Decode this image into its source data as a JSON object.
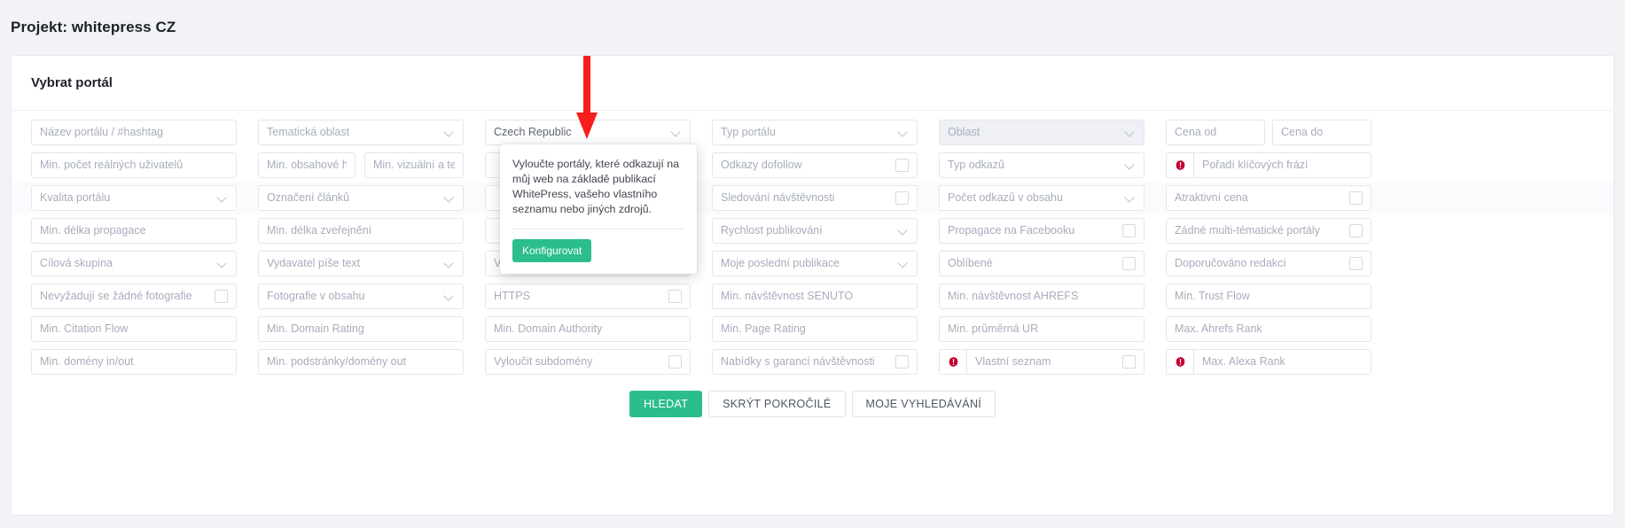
{
  "header": {
    "title": "Projekt: whitepress CZ"
  },
  "card": {
    "title": "Vybrat portál"
  },
  "rows": [
    {
      "alt": false,
      "cells": [
        {
          "name": "portal-name-field",
          "label": "Název portálu / #hashtag",
          "kind": "text",
          "col": "c1"
        },
        {
          "name": "thematic-area-field",
          "label": "Tematická oblast",
          "kind": "select",
          "col": "c2"
        },
        {
          "name": "country-field",
          "label": "Czech Republic",
          "kind": "select",
          "col": "c3",
          "filled": true
        },
        {
          "name": "portal-type-field",
          "label": "Typ portálu",
          "kind": "select",
          "col": "c4"
        },
        {
          "name": "region-field",
          "label": "Oblast",
          "kind": "select",
          "col": "c5",
          "disabled": true
        },
        {
          "name": "price-from-field",
          "label": "Cena od",
          "kind": "text",
          "col": "c6a"
        },
        {
          "name": "price-to-field",
          "label": "Cena do",
          "kind": "text",
          "col": "c6b"
        }
      ]
    },
    {
      "alt": false,
      "cells": [
        {
          "name": "min-real-users-field",
          "label": "Min. počet reálných uživatelů",
          "kind": "text",
          "col": "c1"
        },
        {
          "name": "min-content-rating-field",
          "label": "Min. obsahové hoc",
          "kind": "text",
          "col": "c2a"
        },
        {
          "name": "min-visual-tech-field",
          "label": "Min. vizuální a tecl",
          "kind": "text",
          "col": "c2b"
        },
        {
          "name": "exclude-linked-field",
          "label": "",
          "kind": "text",
          "col": "c3"
        },
        {
          "name": "dofollow-links-field",
          "label": "Odkazy dofollow",
          "kind": "checkbox",
          "col": "c4"
        },
        {
          "name": "link-type-field",
          "label": "Typ odkazů",
          "kind": "select",
          "col": "c5"
        },
        {
          "name": "keyword-ranking-field",
          "label": "Pořadí klíčových frází",
          "kind": "warn-text",
          "col": "c6"
        }
      ]
    },
    {
      "alt": true,
      "cells": [
        {
          "name": "portal-quality-field",
          "label": "Kvalita portálu",
          "kind": "select",
          "col": "c1"
        },
        {
          "name": "article-marking-field",
          "label": "Označení článků",
          "kind": "select",
          "col": "c2"
        },
        {
          "name": "hidden-field-3",
          "label": "",
          "kind": "text",
          "col": "c3"
        },
        {
          "name": "traffic-tracking-field",
          "label": "Sledování návštěvnosti",
          "kind": "checkbox",
          "col": "c4"
        },
        {
          "name": "links-in-content-field",
          "label": "Počet odkazů v obsahu",
          "kind": "select",
          "col": "c5"
        },
        {
          "name": "attractive-price-field",
          "label": "Atraktivní cena",
          "kind": "checkbox",
          "col": "c6"
        }
      ]
    },
    {
      "alt": false,
      "cells": [
        {
          "name": "min-promotion-length-field",
          "label": "Min. délka propagace",
          "kind": "text",
          "col": "c1"
        },
        {
          "name": "min-publication-length-field",
          "label": "Min. délka zveřejnění",
          "kind": "text",
          "col": "c2"
        },
        {
          "name": "hidden-field-4",
          "label": "",
          "kind": "text",
          "col": "c3"
        },
        {
          "name": "publication-speed-field",
          "label": "Rychlost publikování",
          "kind": "select",
          "col": "c4"
        },
        {
          "name": "facebook-promo-field",
          "label": "Propagace na Facebooku",
          "kind": "checkbox",
          "col": "c5"
        },
        {
          "name": "no-multi-thematic-field",
          "label": "Žádné multi-tématické portály",
          "kind": "checkbox",
          "col": "c6"
        }
      ]
    },
    {
      "alt": false,
      "cells": [
        {
          "name": "target-group-field",
          "label": "Cílová skupina",
          "kind": "select",
          "col": "c1"
        },
        {
          "name": "publisher-writes-field",
          "label": "Vydavatel píše text",
          "kind": "select",
          "col": "c2"
        },
        {
          "name": "exclude-linking-domains-field",
          "label": "Vyloučit domény odkazující na mě",
          "kind": "checkbox",
          "col": "c3"
        },
        {
          "name": "my-last-publications-field",
          "label": "Moje poslední publikace",
          "kind": "select",
          "col": "c4"
        },
        {
          "name": "favourites-field",
          "label": "Oblíbené",
          "kind": "checkbox",
          "col": "c5"
        },
        {
          "name": "editor-recommended-field",
          "label": "Doporučováno redakcí",
          "kind": "checkbox",
          "col": "c6"
        }
      ]
    },
    {
      "alt": false,
      "cells": [
        {
          "name": "no-photos-required-field",
          "label": "Nevyžadují se žádné fotografie",
          "kind": "checkbox",
          "col": "c1"
        },
        {
          "name": "photos-in-content-field",
          "label": "Fotografie v obsahu",
          "kind": "select",
          "col": "c2"
        },
        {
          "name": "https-field",
          "label": "HTTPS",
          "kind": "checkbox",
          "col": "c3"
        },
        {
          "name": "min-senuto-traffic-field",
          "label": "Min. návštěvnost SENUTO",
          "kind": "text",
          "col": "c4"
        },
        {
          "name": "min-ahrefs-traffic-field",
          "label": "Min. návštěvnost AHREFS",
          "kind": "text",
          "col": "c5"
        },
        {
          "name": "min-trust-flow-field",
          "label": "Min. Trust Flow",
          "kind": "text",
          "col": "c6"
        }
      ]
    },
    {
      "alt": false,
      "cells": [
        {
          "name": "min-citation-flow-field",
          "label": "Min. Citation Flow",
          "kind": "text",
          "col": "c1"
        },
        {
          "name": "min-domain-rating-field",
          "label": "Min. Domain Rating",
          "kind": "text",
          "col": "c2"
        },
        {
          "name": "min-domain-authority-field",
          "label": "Min. Domain Authority",
          "kind": "text",
          "col": "c3"
        },
        {
          "name": "min-page-rating-field",
          "label": "Min. Page Rating",
          "kind": "text",
          "col": "c4"
        },
        {
          "name": "min-average-ur-field",
          "label": "Min. průměrná UR",
          "kind": "text",
          "col": "c5"
        },
        {
          "name": "max-ahrefs-rank-field",
          "label": "Max. Ahrefs Rank",
          "kind": "text",
          "col": "c6"
        }
      ]
    },
    {
      "alt": false,
      "cells": [
        {
          "name": "min-domains-in-out-field",
          "label": "Min. domény in/out",
          "kind": "text",
          "col": "c1"
        },
        {
          "name": "min-subpages-domains-out-field",
          "label": "Min. podstránky/domény out",
          "kind": "text",
          "col": "c2"
        },
        {
          "name": "exclude-subdomains-field",
          "label": "Vyloučit subdomény",
          "kind": "checkbox",
          "col": "c3"
        },
        {
          "name": "guaranteed-traffic-offers-field",
          "label": "Nabídky s garancí návštěvnosti",
          "kind": "checkbox",
          "col": "c4"
        },
        {
          "name": "custom-list-field",
          "label": "Vlastní seznam",
          "kind": "warn-checkbox",
          "col": "c5"
        },
        {
          "name": "max-alexa-rank-field",
          "label": "Max. Alexa Rank",
          "kind": "warn-text",
          "col": "c6"
        }
      ]
    }
  ],
  "popover": {
    "text": "Vyloučte portály, které odkazují na můj web na základě publikací WhitePress, vašeho vlastního seznamu nebo jiných zdrojů.",
    "button": "Konfigurovat"
  },
  "footer": {
    "search": "HLEDAT",
    "hide_advanced": "SKRÝT POKROČILÉ",
    "my_searches": "MOJE VYHLEDÁVÁNÍ"
  },
  "colors": {
    "accent": "#2bbd8e",
    "warning": "#c2002f",
    "annotation_arrow": "#f81c1c",
    "placeholder": "#a7adbb"
  }
}
